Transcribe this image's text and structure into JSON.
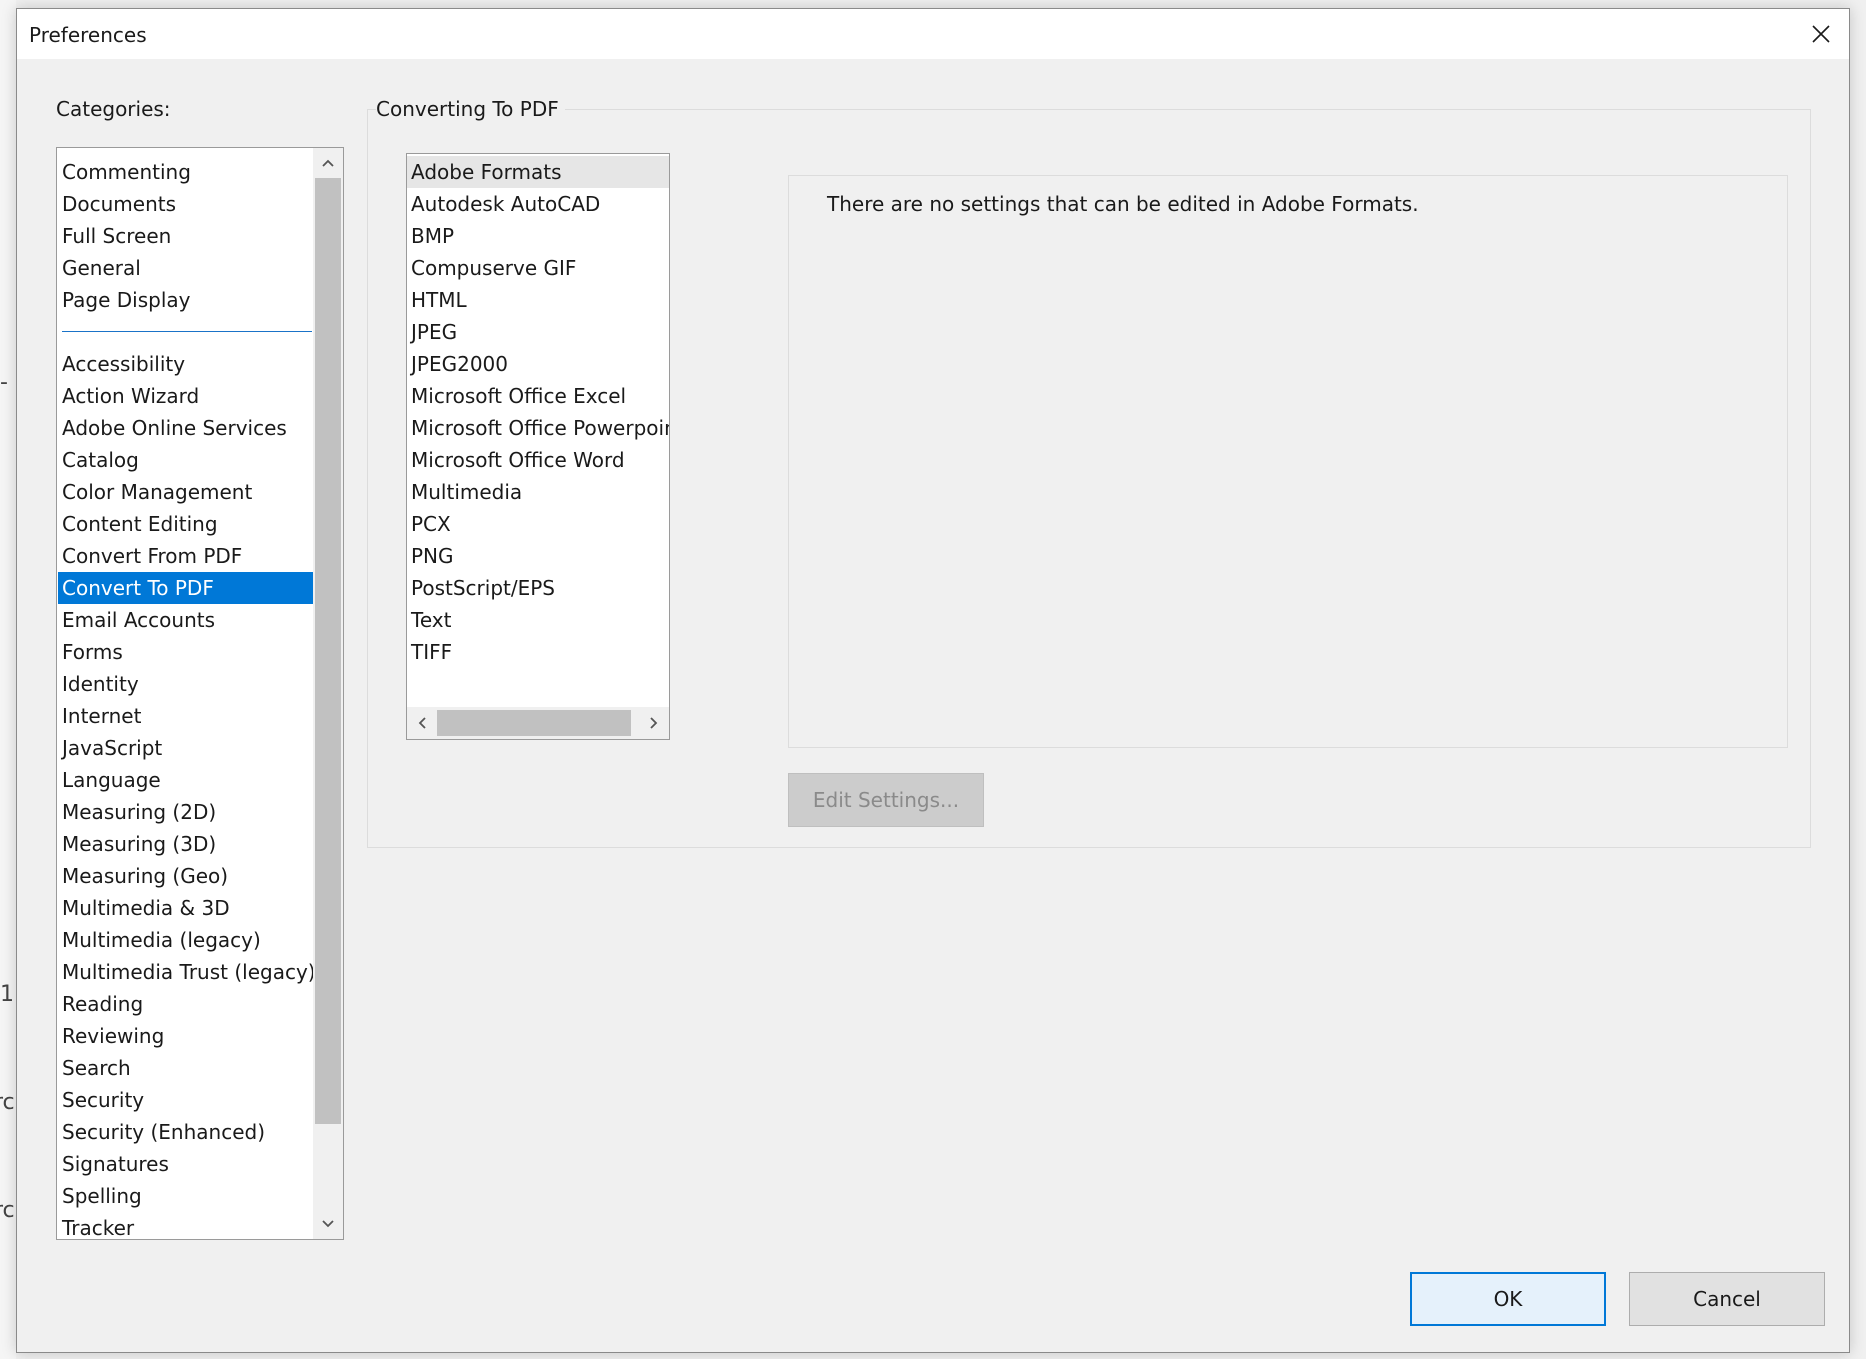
{
  "background_fragments": [
    "-",
    "1",
    "rc",
    "rc"
  ],
  "dialog": {
    "title": "Preferences",
    "close_icon": "close-icon"
  },
  "categories": {
    "label": "Categories:",
    "group_top": [
      "Commenting",
      "Documents",
      "Full Screen",
      "General",
      "Page Display"
    ],
    "group_bottom": [
      "Accessibility",
      "Action Wizard",
      "Adobe Online Services",
      "Catalog",
      "Color Management",
      "Content Editing",
      "Convert From PDF",
      "Convert To PDF",
      "Email Accounts",
      "Forms",
      "Identity",
      "Internet",
      "JavaScript",
      "Language",
      "Measuring (2D)",
      "Measuring (3D)",
      "Measuring (Geo)",
      "Multimedia & 3D",
      "Multimedia (legacy)",
      "Multimedia Trust (legacy)",
      "Reading",
      "Reviewing",
      "Search",
      "Security",
      "Security (Enhanced)",
      "Signatures",
      "Spelling",
      "Tracker"
    ],
    "selected": "Convert To PDF"
  },
  "panel": {
    "title": "Converting To PDF",
    "formats": [
      "Adobe Formats",
      "Autodesk AutoCAD",
      "BMP",
      "Compuserve GIF",
      "HTML",
      "JPEG",
      "JPEG2000",
      "Microsoft Office Excel",
      "Microsoft Office Powerpoint",
      "Microsoft Office Word",
      "Multimedia",
      "PCX",
      "PNG",
      "PostScript/EPS",
      "Text",
      "TIFF"
    ],
    "selected_format": "Adobe Formats",
    "info_text": "There are no settings that can be edited in Adobe Formats.",
    "edit_button": "Edit Settings..."
  },
  "buttons": {
    "ok": "OK",
    "cancel": "Cancel"
  },
  "colors": {
    "selection": "#0078d7",
    "separator": "#1a73c8",
    "dialog_bg": "#f0f0f0"
  }
}
